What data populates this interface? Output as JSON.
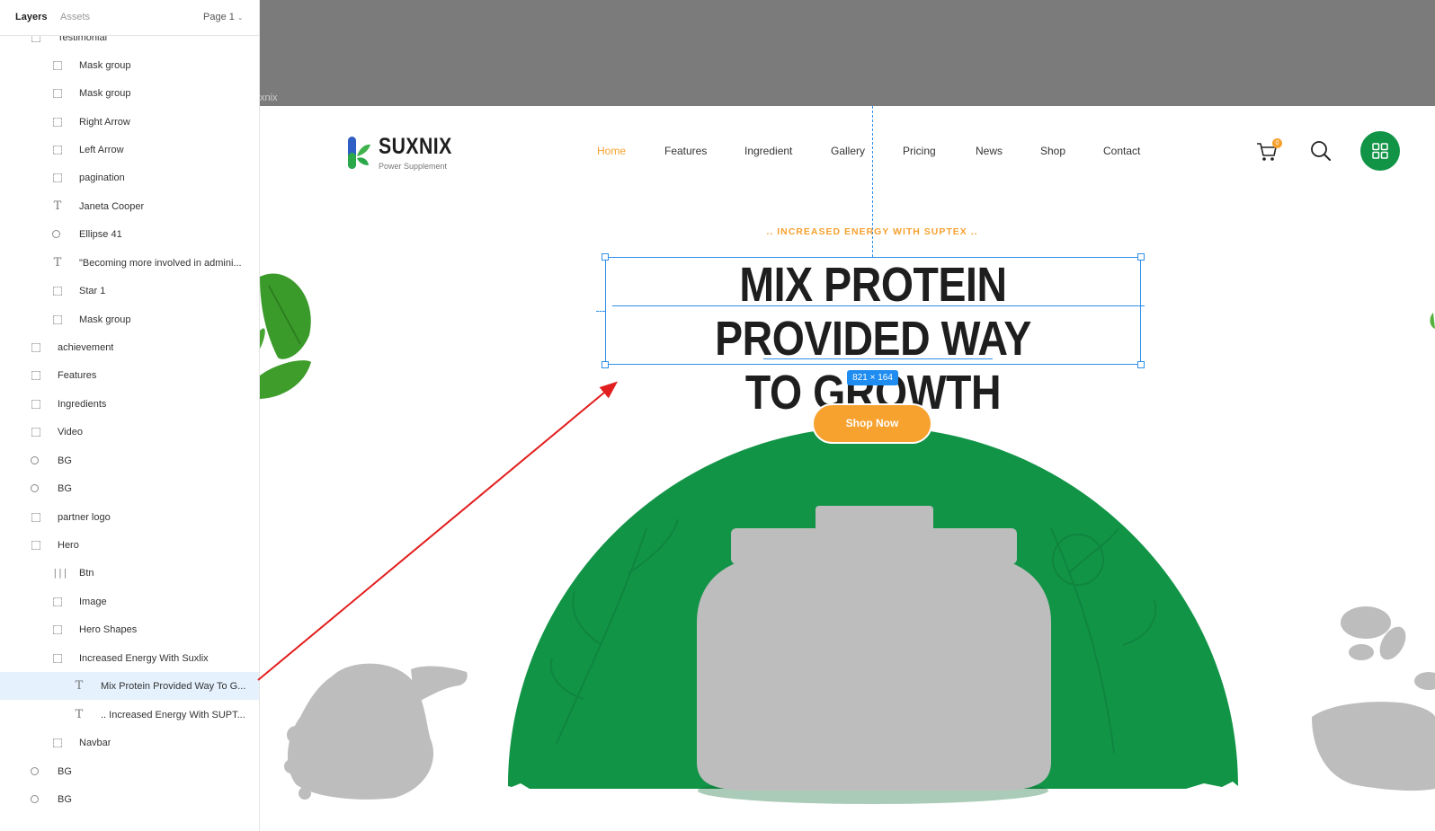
{
  "panel": {
    "tabs": {
      "layers": "Layers",
      "assets": "Assets"
    },
    "page_selector": "Page 1",
    "layers": [
      {
        "label": "Testimonial",
        "icon": "frame"
      },
      {
        "label": "Mask group",
        "icon": "frame"
      },
      {
        "label": "Mask group",
        "icon": "frame"
      },
      {
        "label": "Right Arrow",
        "icon": "frame"
      },
      {
        "label": "Left Arrow",
        "icon": "frame"
      },
      {
        "label": " pagination",
        "icon": "frame"
      },
      {
        "label": "Janeta Cooper",
        "icon": "text"
      },
      {
        "label": "Ellipse 41",
        "icon": "ellipse"
      },
      {
        "label": "\"Becoming more involved in admini...",
        "icon": "text"
      },
      {
        "label": "Star 1",
        "icon": "frame"
      },
      {
        "label": "Mask group",
        "icon": "frame"
      },
      {
        "label": "achievement",
        "icon": "frame"
      },
      {
        "label": "Features",
        "icon": "frame"
      },
      {
        "label": "Ingredients",
        "icon": "frame"
      },
      {
        "label": "Video",
        "icon": "frame"
      },
      {
        "label": "BG",
        "icon": "ellipse"
      },
      {
        "label": "BG",
        "icon": "ellipse"
      },
      {
        "label": "partner logo",
        "icon": "frame"
      },
      {
        "label": "Hero",
        "icon": "frame"
      },
      {
        "label": "Btn",
        "icon": "auto-layout"
      },
      {
        "label": "Image",
        "icon": "frame"
      },
      {
        "label": "Hero Shapes",
        "icon": "frame"
      },
      {
        "label": "Increased Energy With Suxlix",
        "icon": "frame"
      },
      {
        "label": "Mix Protein Provided Way To G...",
        "icon": "text",
        "selected": true
      },
      {
        "label": ".. Increased Energy With SUPT...",
        "icon": "text"
      },
      {
        "label": "Navbar",
        "icon": "frame"
      },
      {
        "label": "BG",
        "icon": "ellipse"
      },
      {
        "label": "BG",
        "icon": "ellipse"
      }
    ]
  },
  "canvas": {
    "frame_label": "xnix",
    "logo": {
      "wordmark": "SUXNIX",
      "tagline": "Power Supplement"
    },
    "nav": [
      "Home",
      "Features",
      "Ingredient",
      "Gallery",
      "Pricing",
      "News",
      "Shop",
      "Contact"
    ],
    "nav_active": "Home",
    "cart_badge": "0",
    "hero": {
      "subtitle": ".. INCREASED ENERGY WITH SUPTEX ..",
      "title_line1": "MIX PROTEIN PROVIDED WAY",
      "title_line2": "TO GROWTH",
      "selection_size": "821 × 164",
      "button": "Shop Now"
    }
  },
  "colors": {
    "accent_orange": "#f7a12f",
    "brand_green": "#129447",
    "selection_blue": "#2f8fe8",
    "placeholder_gray": "#bdbdbd",
    "annotation_red": "#e21d1d"
  }
}
